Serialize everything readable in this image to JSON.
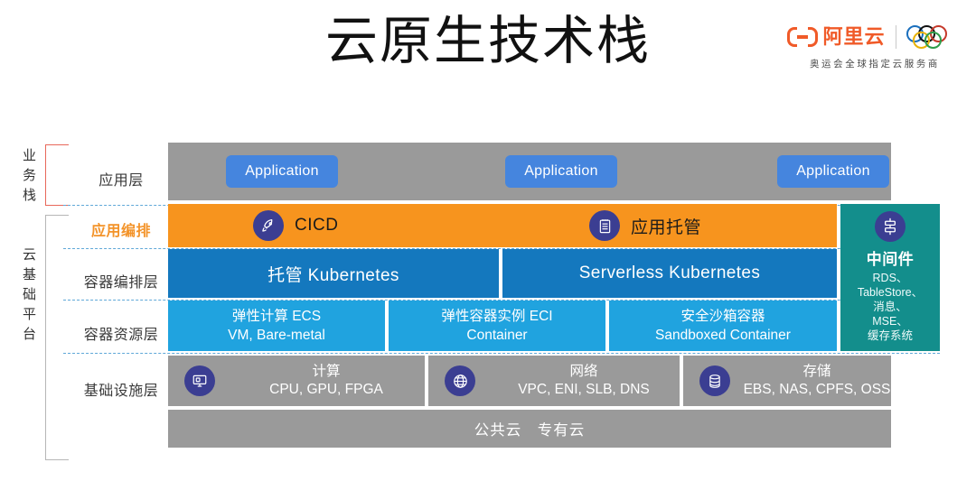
{
  "header": {
    "title": "云原生技术栈",
    "brand": {
      "logo_text": "阿里云",
      "logo_mark": "alibaba-cloud-mark",
      "rings_icon": "olympic-rings-icon",
      "tagline": "奥运会全球指定云服务商"
    }
  },
  "diagram": {
    "groups": [
      {
        "label": "业务栈",
        "bracket_color": "#E8685A"
      },
      {
        "label": "云基础平台",
        "bracket_color": "#b6b6b6"
      }
    ],
    "row_labels": [
      {
        "label": "应用层",
        "accent": false
      },
      {
        "label": "应用编排",
        "accent": true
      },
      {
        "label": "容器编排层",
        "accent": false
      },
      {
        "label": "容器资源层",
        "accent": false
      },
      {
        "label": "基础设施层",
        "accent": false
      }
    ],
    "application_layer": {
      "background": "#9a9a9a",
      "buttons": [
        {
          "label": "Application"
        },
        {
          "label": "Application"
        },
        {
          "label": "Application"
        }
      ],
      "button_color": "#4585DE"
    },
    "orchestration_layer": {
      "background": "#F7941E",
      "items": [
        {
          "icon": "rocket-icon",
          "label": "CICD"
        },
        {
          "icon": "clipboard-icon",
          "label": "应用托管"
        }
      ]
    },
    "kubernetes_layer": {
      "background": "#1478BE",
      "cells": [
        {
          "label": "托管 Kubernetes"
        },
        {
          "label": "Serverless Kubernetes"
        }
      ]
    },
    "container_resource_layer": {
      "background": "#20A3DF",
      "cells": [
        {
          "title": "弹性计算 ECS",
          "sub": "VM, Bare-metal"
        },
        {
          "title": "弹性容器实例 ECI",
          "sub": "Container"
        },
        {
          "title": "安全沙箱容器",
          "sub": "Sandboxed Container"
        }
      ]
    },
    "middleware": {
      "background": "#138E8C",
      "icon": "middleware-icon",
      "title": "中间件",
      "items": "RDS、\nTableStore、\n消息、\nMSE、\n缓存系统"
    },
    "infrastructure_layer": {
      "background": "#9a9a9a",
      "cells": [
        {
          "icon": "monitor-icon",
          "title": "计算",
          "sub": "CPU, GPU, FPGA"
        },
        {
          "icon": "globe-icon",
          "title": "网络",
          "sub": "VPC, ENI, SLB, DNS"
        },
        {
          "icon": "database-icon",
          "title": "存储",
          "sub": "EBS, NAS, CPFS, OSS"
        }
      ]
    },
    "cloud_bar": {
      "label": "公共云　专有云",
      "background": "#9a9a9a"
    }
  }
}
